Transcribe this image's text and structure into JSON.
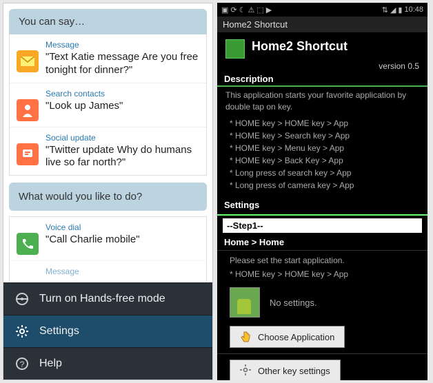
{
  "left": {
    "say_header": "You can say…",
    "examples": [
      {
        "category": "Message",
        "quote": "\"Text Katie message Are you free tonight for dinner?\"",
        "icon": "message-icon",
        "color": "#f9a825"
      },
      {
        "category": "Search contacts",
        "quote": "\"Look up James\"",
        "icon": "contact-icon",
        "color": "#ff7043"
      },
      {
        "category": "Social update",
        "quote": "\"Twitter update Why do humans live so far north?\"",
        "icon": "social-icon",
        "color": "#ff7043"
      }
    ],
    "prompt": "What would you like to do?",
    "voice_dial_cat": "Voice dial",
    "voice_dial_quote": "\"Call Charlie mobile\"",
    "message_peek": "Message",
    "menu": {
      "handsfree": "Turn on Hands-free mode",
      "settings": "Settings",
      "help": "Help"
    }
  },
  "right": {
    "statusbar": {
      "time": "10:48"
    },
    "titlebar": "Home2 Shortcut",
    "app_name": "Home2 Shortcut",
    "version": "version 0.5",
    "desc_header": "Description",
    "desc_text": "This application starts your favorite application by double tap on key.",
    "desc_items": [
      "* HOME key > HOME key > App",
      "* HOME key > Search key > App",
      "* HOME key > Menu key > App",
      "* HOME key > Back Key > App",
      "* Long press of search key > App",
      "* Long press of camera key > App"
    ],
    "settings_header": "Settings",
    "step1": "--Step1--",
    "home_home": "Home > Home",
    "please_set": "Please set the start application.",
    "please_item": "* HOME key > HOME key > App",
    "no_settings": "No settings.",
    "choose_app": "Choose Application",
    "other_key": "Other key settings"
  }
}
